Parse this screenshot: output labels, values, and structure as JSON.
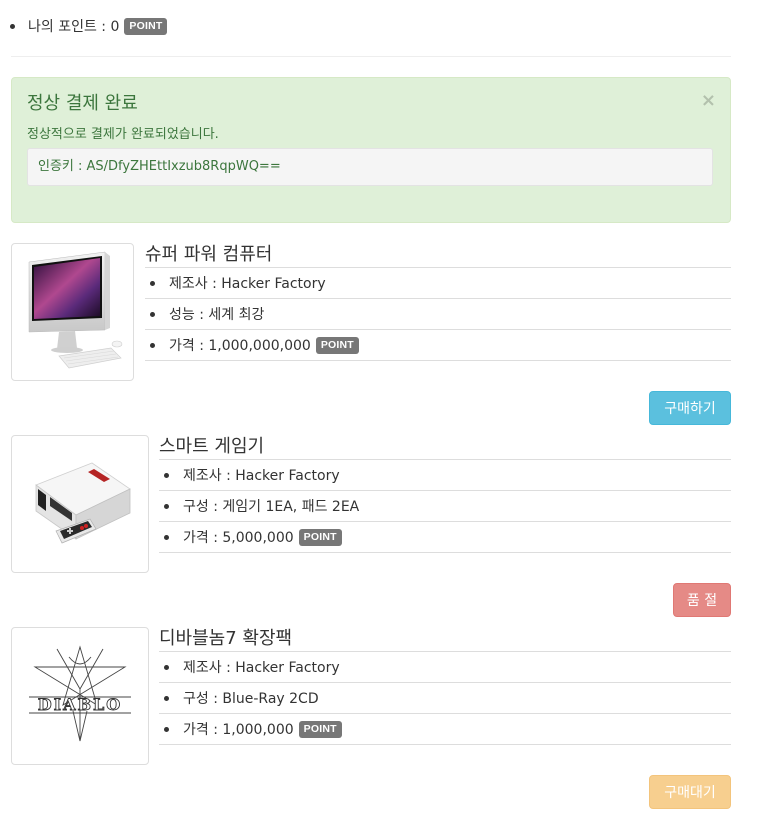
{
  "points": {
    "label": "나의 포인트 : 0",
    "badge": "POINT"
  },
  "alert": {
    "title": "정상 결제 완료",
    "close": "×",
    "message": "정상적으로 결제가 완료되었습니다.",
    "auth_key": "인증키 : AS/DfyZHEttIxzub8RqpWQ=="
  },
  "products": [
    {
      "title": "슈퍼 파워 컴퓨터",
      "rows": [
        "제조사 : Hacker Factory",
        "성능 : 세계 최강",
        "가격 : 1,000,000,000"
      ],
      "badge": "POINT",
      "button": "구매하기",
      "button_color": "#5bc0de",
      "image_icon": "computer-image"
    },
    {
      "title": "스마트 게임기",
      "rows": [
        "제조사 : Hacker Factory",
        "구성 : 게임기 1EA, 패드 2EA",
        "가격 : 5,000,000"
      ],
      "badge": "POINT",
      "button": "품 절",
      "button_color": "#e58a86",
      "image_icon": "game-console-image"
    },
    {
      "title": "디바블놈7 확장팩",
      "rows": [
        "제조사 : Hacker Factory",
        "구성 : Blue-Ray 2CD",
        "가격 : 1,000,000"
      ],
      "badge": "POINT",
      "button": "구매대기",
      "button_color": "#f7cf8f",
      "image_icon": "diablo-logo-image",
      "image_text": "DIABLO"
    }
  ]
}
